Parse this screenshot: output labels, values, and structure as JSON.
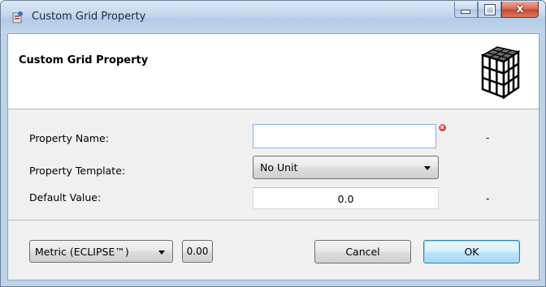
{
  "window": {
    "title": "Custom Grid Property",
    "close_glyph": "x"
  },
  "banner": {
    "title": "Custom Grid Property",
    "icon": "grid-cube-icon"
  },
  "form": {
    "property_name": {
      "label": "Property Name:",
      "value": "",
      "unit": "-",
      "error_glyph": "x"
    },
    "property_template": {
      "label": "Property Template:",
      "selected": "No Unit"
    },
    "default_value": {
      "label": "Default Value:",
      "value": "0.0",
      "unit": "-"
    }
  },
  "footer": {
    "unit_system": "Metric (ECLIPSE™)",
    "precision": "0.00",
    "cancel_label": "Cancel",
    "ok_label": "OK"
  },
  "colors": {
    "ok_accent": "#3c7fb1",
    "error": "#c01818",
    "focus_border": "#7eb4ea"
  }
}
